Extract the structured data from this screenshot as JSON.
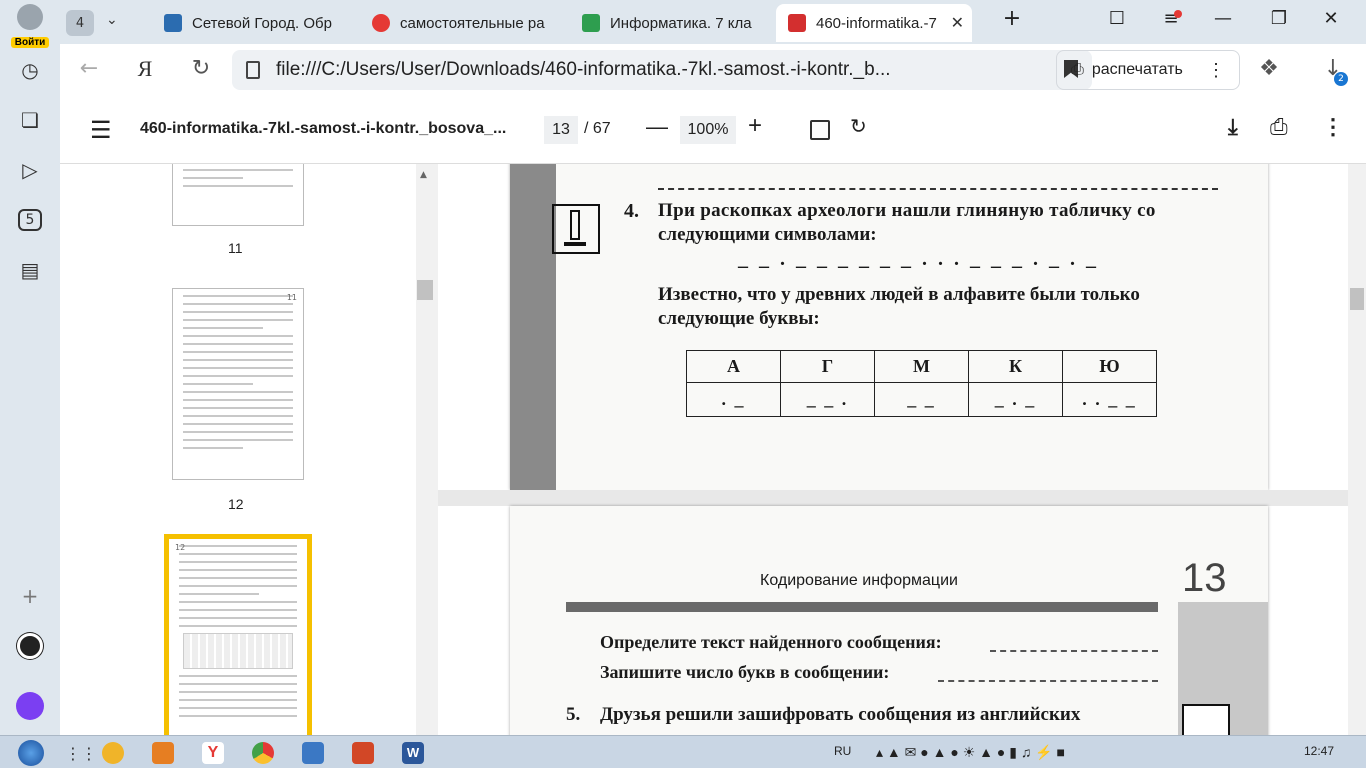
{
  "sidebar": {
    "login_label": "Войти",
    "badge_count": "5"
  },
  "tabs": {
    "count": "4",
    "items": [
      {
        "title": "Сетевой Город. Обр",
        "color": "#2b6cb0"
      },
      {
        "title": "самостоятельные ра",
        "color": "#e53935"
      },
      {
        "title": "Информатика. 7 кла",
        "color": "#2e9e4f"
      },
      {
        "title": "460-informatika.-7",
        "color": "#d32f2f"
      }
    ],
    "new_tab": "+"
  },
  "address": {
    "url": "file:///C:/Users/User/Downloads/460-informatika.-7kl.-samost.-i-kontr._b...",
    "print_label": "распечатать",
    "downloads_count": "2"
  },
  "pdf_toolbar": {
    "filename": "460-informatika.-7kl.-samost.-i-kontr._bosova_...",
    "current_page": "13",
    "total_pages": "/ 67",
    "zoom": "100%"
  },
  "thumbnails": {
    "labels": [
      "11",
      "12"
    ],
    "thumb12_corner": "11",
    "thumb13_corner": "12"
  },
  "doc": {
    "task4_number": "4.",
    "task4_line1": "При раскопках археологи нашли  глиняную табличку со",
    "task4_line2": "следующими символами:",
    "code_sequence": "_ _ . _ _ _ _ _ _ . . . _ _ _ . _ . _",
    "known_line1": "Известно, что у древних людей в алфавите были только",
    "known_line2": "следующие буквы:",
    "table_headers": [
      "А",
      "Г",
      "М",
      "К",
      "Ю"
    ],
    "table_codes": [
      ". _",
      "_ _ .",
      "_ _",
      "_ . _",
      ". . _ _"
    ],
    "page13_header": "Кодирование информации",
    "page13_number": "13",
    "line_define": "Определите текст найденного сообщения:",
    "line_count": "Запишите число букв в сообщении:",
    "task5_number": "5.",
    "task5_text": "Друзья решили зашифровать сообщения из английских"
  },
  "taskbar": {
    "lang": "RU",
    "time": "12:47"
  }
}
